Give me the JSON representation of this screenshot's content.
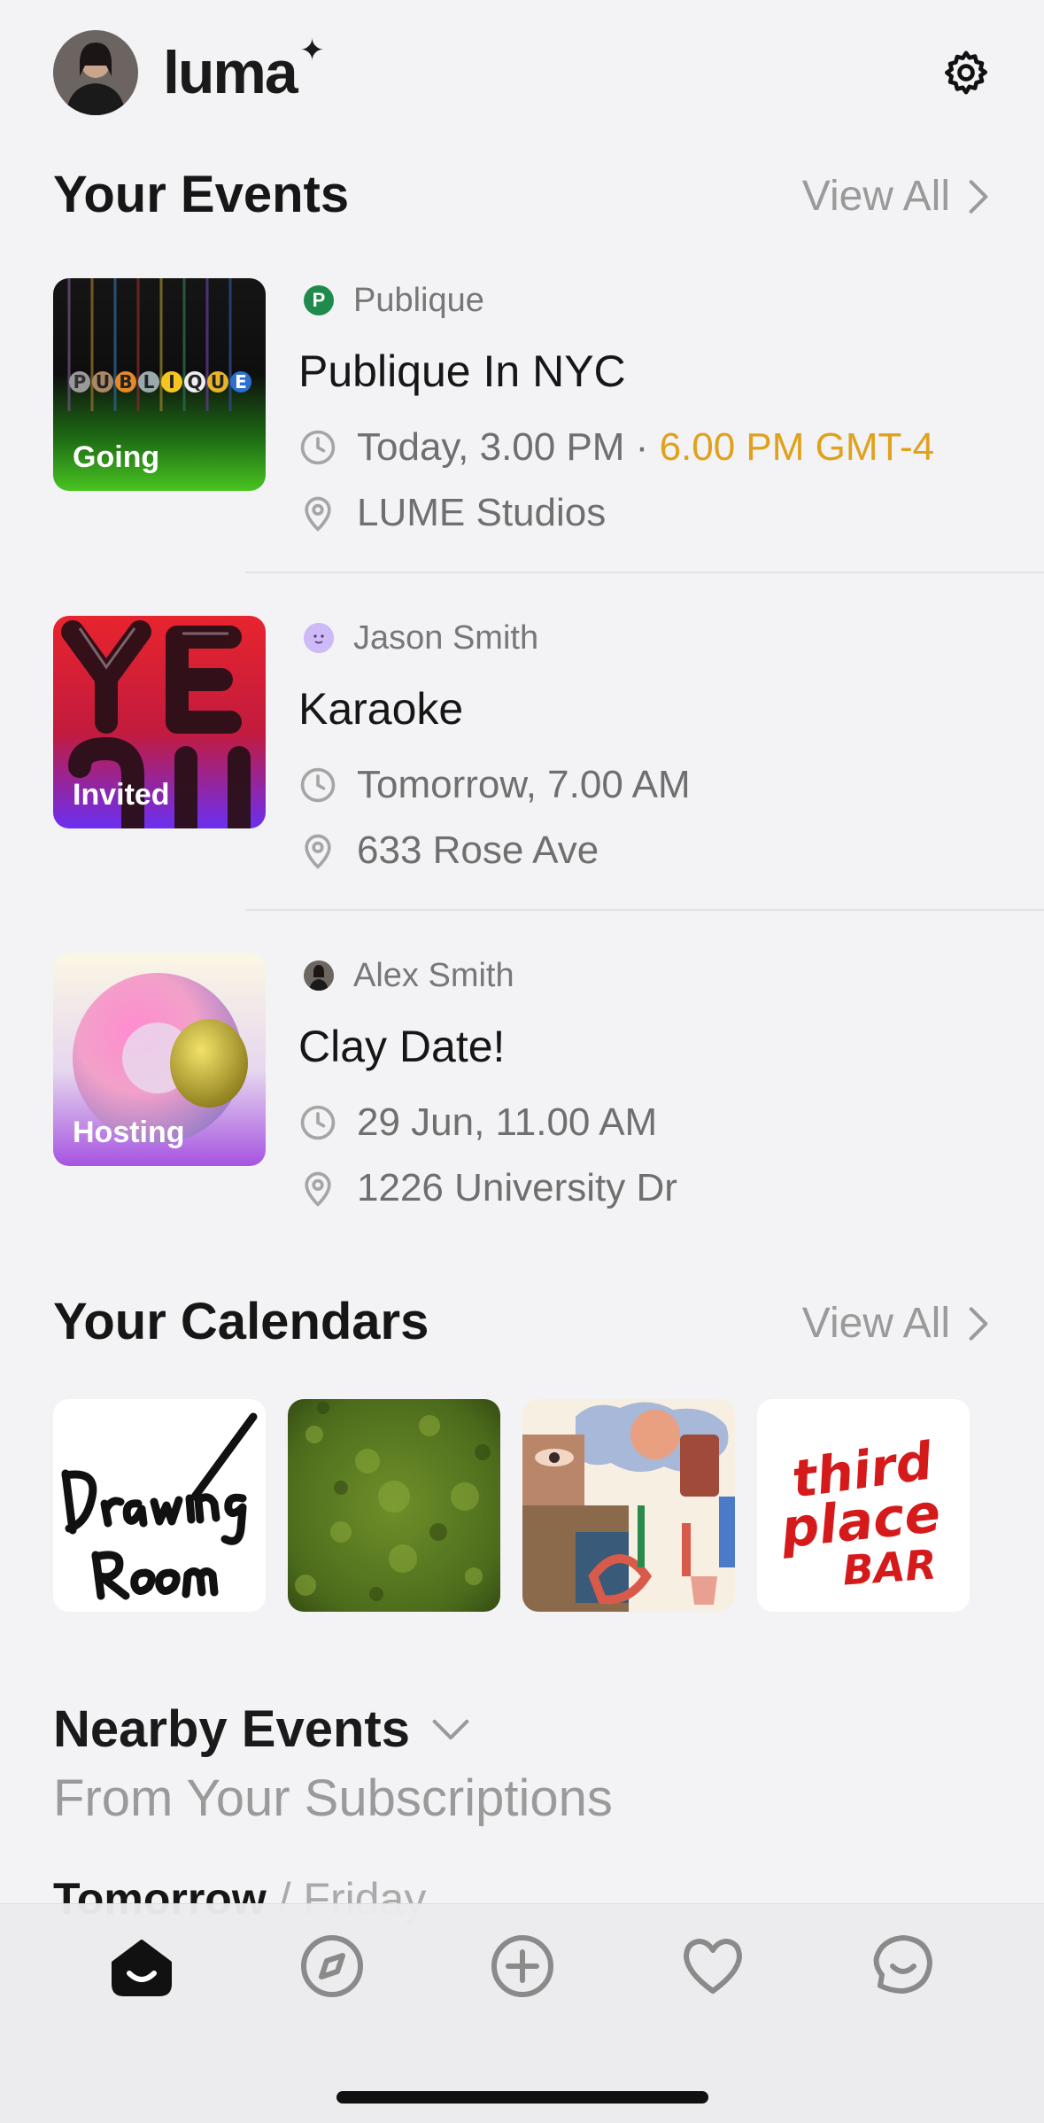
{
  "header": {
    "app_name": "luma",
    "icons": [
      "avatar",
      "gear-icon"
    ]
  },
  "events_section": {
    "title": "Your Events",
    "view_all": "View All"
  },
  "events": [
    {
      "status": "Going",
      "host": "Publique",
      "host_badge": "P",
      "title": "Publique In NYC",
      "time": "Today, 3.00 PM · ",
      "time_accent": "6.00 PM GMT-4",
      "location": "LUME Studios"
    },
    {
      "status": "Invited",
      "host": "Jason Smith",
      "host_badge": "",
      "title": "Karaoke",
      "time": "Tomorrow, 7.00 AM",
      "time_accent": "",
      "location": "633 Rose Ave"
    },
    {
      "status": "Hosting",
      "host": "Alex Smith",
      "host_badge": "",
      "title": "Clay Date!",
      "time": "29 Jun, 11.00 AM",
      "time_accent": "",
      "location": "1226 University Dr"
    }
  ],
  "calendars_section": {
    "title": "Your Calendars",
    "view_all": "View All"
  },
  "nearby": {
    "title": "Nearby Events",
    "subtitle": "From Your Subscriptions",
    "day": "Tomorrow",
    "separator": " / ",
    "weekday": "Friday"
  },
  "tabbar": {
    "tabs": [
      "home-icon",
      "compass-icon",
      "plus-circle-icon",
      "heart-icon",
      "chat-icon"
    ],
    "active": "home-icon"
  },
  "colors": {
    "accent": "#e0a11c",
    "muted": "#9a9a9a",
    "background": "#f3f3f5"
  }
}
